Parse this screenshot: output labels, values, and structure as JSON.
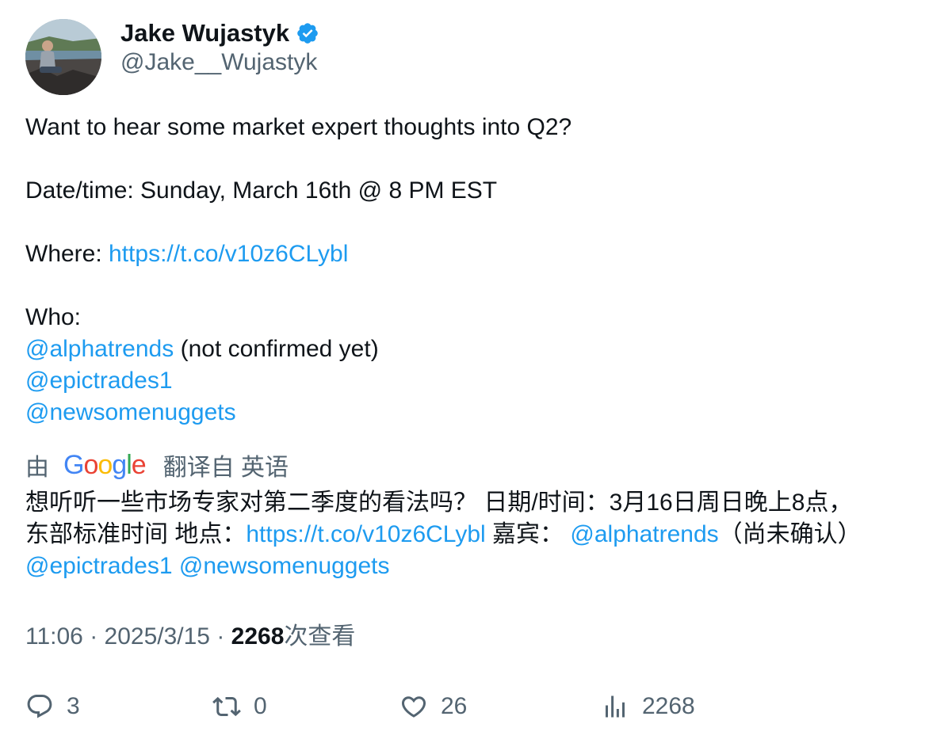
{
  "author": {
    "display_name": "Jake Wujastyk",
    "handle": "@Jake__Wujastyk",
    "verified": true,
    "verified_icon": "verified-badge-icon"
  },
  "tweet": {
    "line1": "Want to hear some market expert thoughts into Q2?",
    "line2": "Date/time: Sunday, March 16th @ 8 PM EST",
    "where_label": "Where: ",
    "where_link": "https://t.co/v10z6CLybl",
    "who_label": "Who:",
    "mention1": "@alphatrends",
    "mention1_note": " (not confirmed yet)",
    "mention2": "@epictrades1",
    "mention3": "@newsomenuggets"
  },
  "translation": {
    "by_label": "由",
    "provider": "Google",
    "from_label": "翻译自 英语",
    "line1": "想听听一些市场专家对第二季度的看法吗？ 日期/时间：3月16日周日晚上8点，",
    "line2_prefix": "东部标准时间 地点：",
    "line2_link": "https://t.co/v10z6CLybl",
    "line2_guests": " 嘉宾： ",
    "line2_mention": "@alphatrends",
    "line2_suffix": "（尚未确认）",
    "line3_mention1": "@epictrades1",
    "line3_mention2": "@newsomenuggets"
  },
  "meta": {
    "time": "11:06",
    "separator": " · ",
    "date": "2025/3/15",
    "views_count": "2268",
    "views_label": "次查看"
  },
  "actions": {
    "replies": "3",
    "reposts": "0",
    "likes": "26",
    "views": "2268"
  },
  "colors": {
    "link": "#1d9bf0",
    "secondary_text": "#536471",
    "primary_text": "#0f1419"
  }
}
